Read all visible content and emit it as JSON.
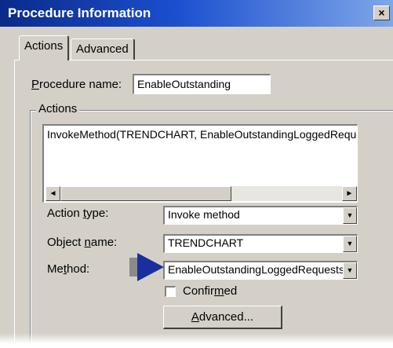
{
  "window": {
    "title": "Procedure Information",
    "close_glyph": "×",
    "colors": {
      "titlebar_start": "#0b2a8a",
      "titlebar_end": "#7fa7e8",
      "face": "#d4d0c8",
      "pointer": "#1a2f9e"
    }
  },
  "tabs": [
    {
      "label": "Actions",
      "active": true
    },
    {
      "label": "Advanced",
      "active": false
    }
  ],
  "procedure": {
    "label_prefix": "",
    "label_mnemonic": "P",
    "label_rest": "rocedure name:",
    "value": "EnableOutstanding"
  },
  "actions_group": {
    "legend": "Actions",
    "list_items": [
      "InvokeMethod(TRENDCHART, EnableOutstandingLoggedRequests"
    ],
    "scroll_left_icon": "◄",
    "scroll_right_icon": "►"
  },
  "fields": {
    "action_type": {
      "label_prefix": "Action ",
      "label_mnemonic": "t",
      "label_rest": "ype:",
      "value": "Invoke method"
    },
    "object_name": {
      "label_prefix": "Object ",
      "label_mnemonic": "n",
      "label_rest": "ame:",
      "value": "TRENDCHART"
    },
    "method": {
      "label_prefix": "Me",
      "label_mnemonic": "t",
      "label_rest": "hod:",
      "value": "EnableOutstandingLoggedRequests"
    },
    "dropdown_icon": "▼"
  },
  "confirmed": {
    "label_prefix": "Confir",
    "label_mnemonic": "m",
    "label_rest": "ed",
    "checked": false
  },
  "advanced_button": {
    "label_prefix": "",
    "label_mnemonic": "A",
    "label_rest": "dvanced..."
  },
  "icons": {
    "close": "close-icon",
    "pointer": "arrow-pointer-icon",
    "dropdown": "chevron-down-icon"
  }
}
